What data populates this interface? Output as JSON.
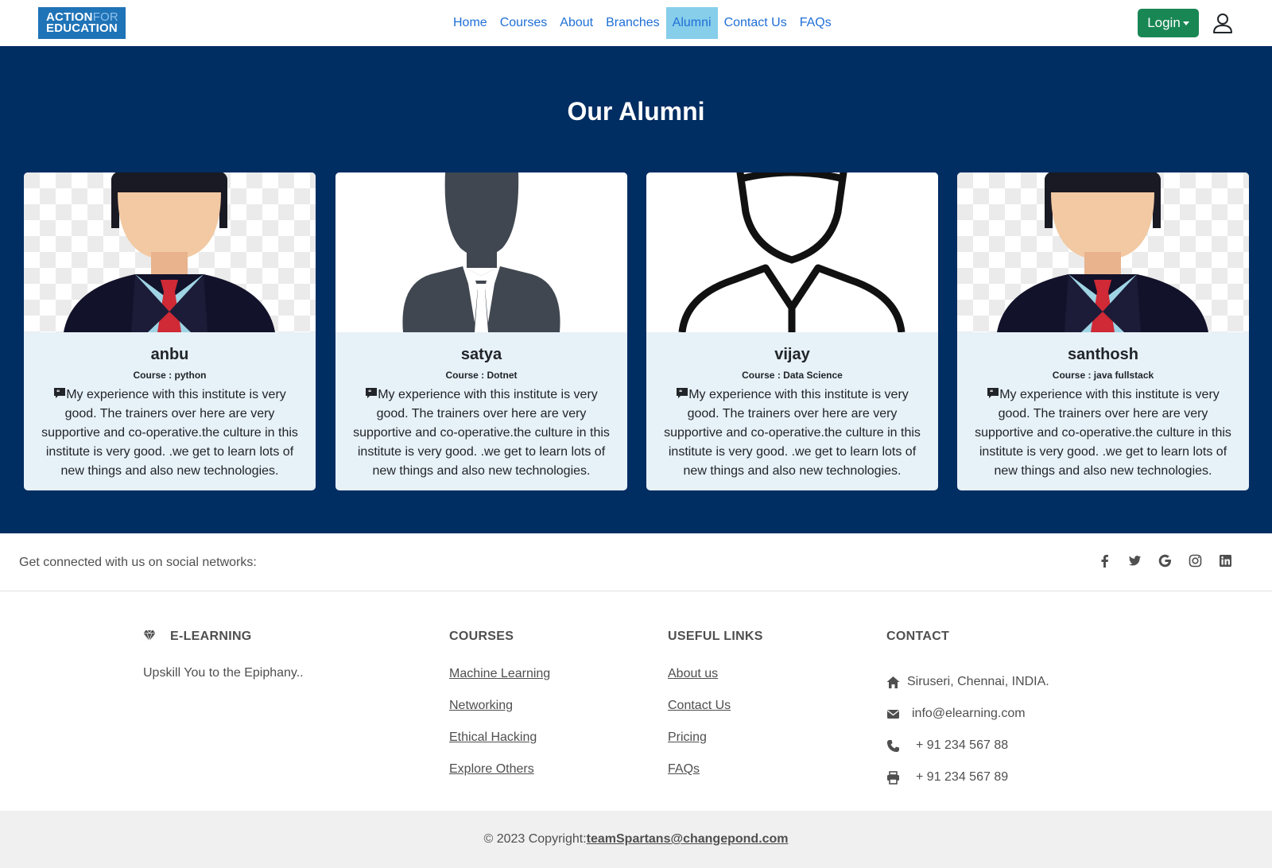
{
  "navbar": {
    "logo_line1": "ACTION",
    "logo_line1_light": "FOR",
    "logo_line2": "EDUCATION",
    "links": [
      "Home",
      "Courses",
      "About",
      "Branches",
      "Alumni",
      "Contact Us",
      "FAQs"
    ],
    "active_link": "Alumni",
    "login_label": "Login"
  },
  "alumni": {
    "title": "Our Alumni",
    "cards": [
      {
        "name": "anbu",
        "course": "Course : python",
        "avatar": "cartoon-businessman",
        "text": "My experience with this institute is very good. The trainers over here are very supportive and co-operative.the culture in this institute is very good. .we get to learn lots of new things and also new technologies."
      },
      {
        "name": "satya",
        "course": "Course : Dotnet",
        "avatar": "silhouette-businessman",
        "text": "My experience with this institute is very good. The trainers over here are very supportive and co-operative.the culture in this institute is very good. .we get to learn lots of new things and also new technologies."
      },
      {
        "name": "vijay",
        "course": "Course : Data Science",
        "avatar": "outline-person",
        "text": "My experience with this institute is very good. The trainers over here are very supportive and co-operative.the culture in this institute is very good. .we get to learn lots of new things and also new technologies."
      },
      {
        "name": "santhosh",
        "course": "Course : java fullstack",
        "avatar": "cartoon-businessman",
        "text": "My experience with this institute is very good. The trainers over here are very supportive and co-operative.the culture in this institute is very good. .we get to learn lots of new things and also new technologies."
      }
    ]
  },
  "social": {
    "text": "Get connected with us on social networks:",
    "icons": [
      "facebook-icon",
      "twitter-icon",
      "google-icon",
      "instagram-icon",
      "linkedin-icon"
    ]
  },
  "footer": {
    "brand": {
      "title": "E-LEARNING",
      "tagline": "Upskill You to the Epiphany.."
    },
    "courses": {
      "title": "COURSES",
      "links": [
        "Machine Learning",
        "Networking",
        "Ethical Hacking",
        "Explore Others"
      ]
    },
    "useful": {
      "title": "USEFUL LINKS",
      "links": [
        "About us",
        "Contact Us",
        "Pricing",
        "FAQs"
      ]
    },
    "contact": {
      "title": "CONTACT",
      "address": "Siruseri, Chennai, INDIA.",
      "email": "info@elearning.com",
      "phone": "+ 91 234 567 88",
      "fax": "+ 91 234 567 89"
    }
  },
  "copyright": {
    "prefix": "© 2023 Copyright:",
    "link": "teamSpartans@changepond.com"
  },
  "colors": {
    "hero_bg": "#002d62",
    "card_bg": "#e7f1f8",
    "login_bg": "#198754",
    "nav_active_bg": "#87ceeb",
    "nav_link": "#1f6fd6"
  }
}
